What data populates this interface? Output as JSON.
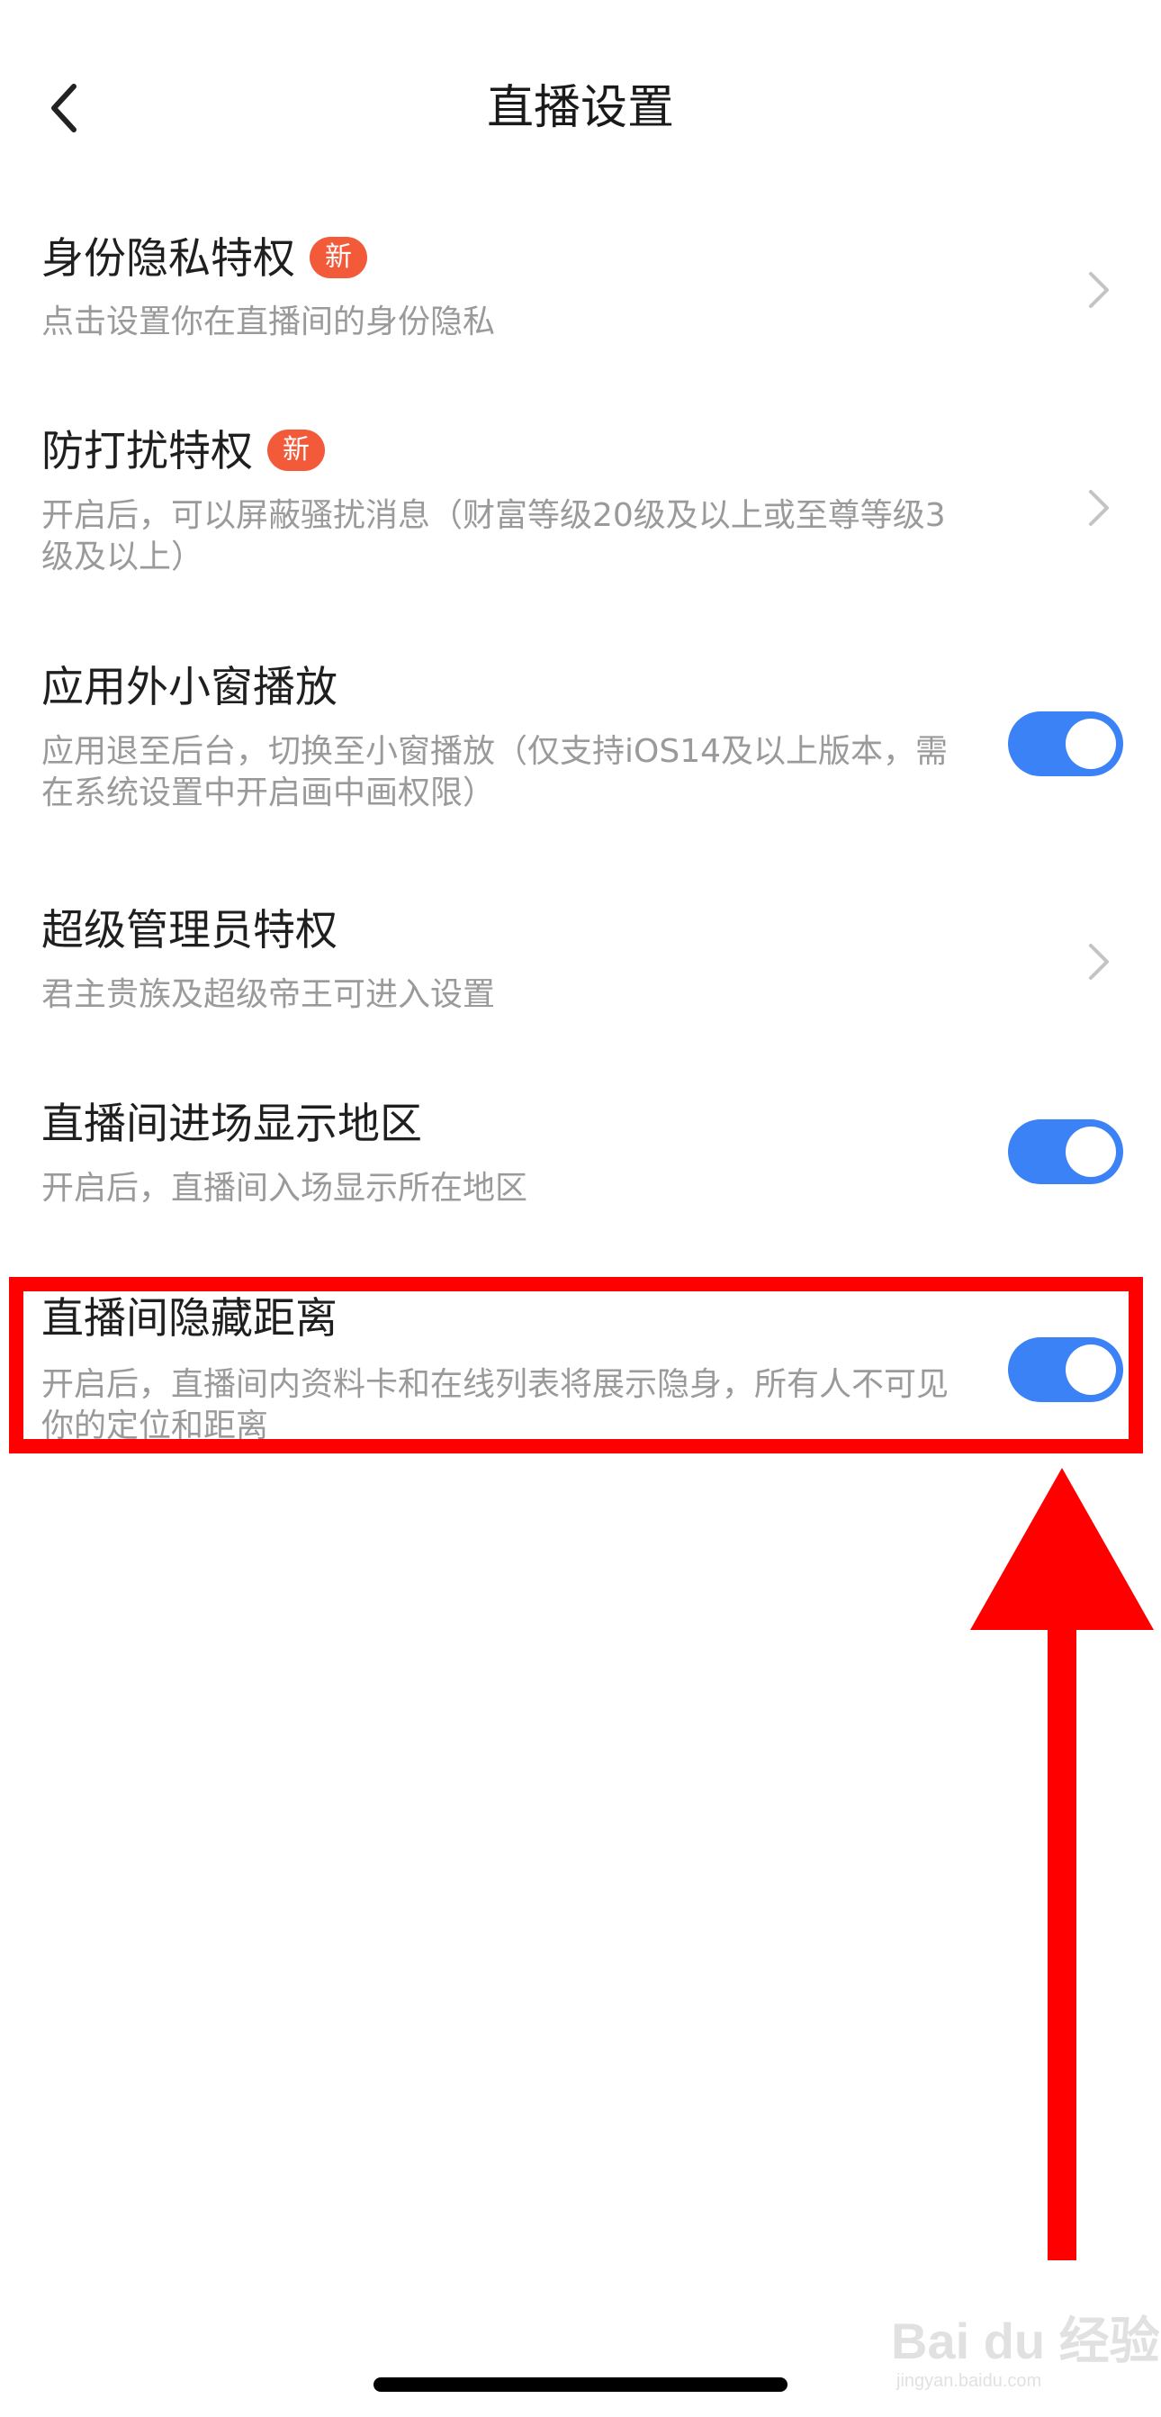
{
  "header": {
    "title": "直播设置"
  },
  "settings": [
    {
      "title": "身份隐私特权",
      "badge": "新",
      "desc": "点击设置你在直播间的身份隐私",
      "control": "chevron"
    },
    {
      "title": "防打扰特权",
      "badge": "新",
      "desc": "开启后，可以屏蔽骚扰消息（财富等级20级及以上或至尊等级3级及以上）",
      "control": "chevron"
    },
    {
      "title": "应用外小窗播放",
      "desc": "应用退至后台，切换至小窗播放（仅支持iOS14及以上版本，需在系统设置中开启画中画权限）",
      "control": "toggle",
      "on": true
    },
    {
      "title": "超级管理员特权",
      "desc": "君主贵族及超级帝王可进入设置",
      "control": "chevron"
    },
    {
      "title": "直播间进场显示地区",
      "desc": "开启后，直播间入场显示所在地区",
      "control": "toggle",
      "on": true
    },
    {
      "title": "直播间隐藏距离",
      "desc": "开启后，直播间内资料卡和在线列表将展示隐身，所有人不可见你的定位和距离",
      "control": "toggle",
      "on": true
    }
  ],
  "colors": {
    "toggle_on": "#3b82f6",
    "badge": "#f25a3a",
    "annotation": "#ff0000"
  },
  "watermark": {
    "brand": "Bai du 经验",
    "url": "jingyan.baidu.com"
  }
}
